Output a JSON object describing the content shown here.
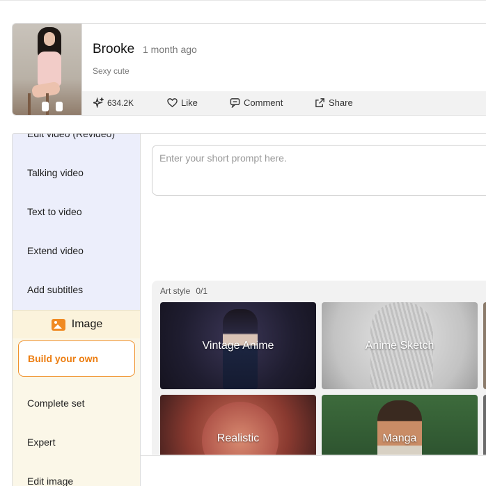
{
  "post": {
    "author": "Brooke",
    "time": "1 month ago",
    "description": "Sexy cute",
    "views": "634.2K",
    "like": "Like",
    "comment": "Comment",
    "share": "Share"
  },
  "sidebar": {
    "video_items": [
      "Edit video (Revideo)",
      "Talking video",
      "Text to video",
      "Extend video",
      "Add subtitles"
    ],
    "image_header": "Image",
    "image_items": [
      "Build your own",
      "Complete set",
      "Expert",
      "Edit image"
    ]
  },
  "prompt": {
    "placeholder": "Enter your short prompt here."
  },
  "art_style": {
    "label": "Art style",
    "count": "0/1",
    "styles": [
      "Vintage Anime",
      "Anime Sketch",
      "Realistic",
      "Manga"
    ]
  },
  "colors": {
    "accent": "#f08a22",
    "sidebar_bg": "#eceefb",
    "image_bg": "#fbf7e8"
  }
}
